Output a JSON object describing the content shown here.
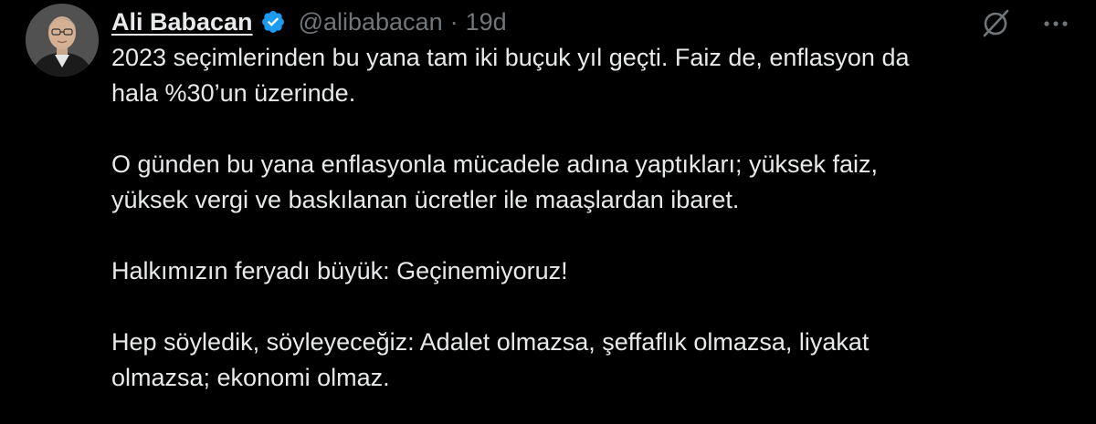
{
  "author": {
    "display_name": "Ali Babacan",
    "handle": "@alibabacan",
    "separator": "·",
    "time": "19d",
    "verified": true,
    "verified_color": "#1d9bf0"
  },
  "icons": {
    "avatar": "profile-photo",
    "verified": "verified-badge-icon",
    "grok": "grok-icon",
    "more": "more-options-icon"
  },
  "tweet": {
    "paragraphs": [
      "2023 seçimlerinden bu yana tam iki buçuk yıl geçti. Faiz de, enflasyon da\nhala %30’un üzerinde.",
      "O günden bu yana enflasyonla mücadele adına yaptıkları; yüksek faiz,\nyüksek vergi ve baskılanan ücretler ile maaşlardan ibaret.",
      "Halkımızın feryadı büyük: Geçinemiyoruz!",
      "Hep söyledik, söyleyeceğiz: Adalet olmazsa, şeffaflık olmazsa, liyakat\nolmazsa; ekonomi olmaz."
    ]
  },
  "colors": {
    "background": "#000000",
    "text": "#e7e9ea",
    "secondary_text": "#71767b"
  }
}
